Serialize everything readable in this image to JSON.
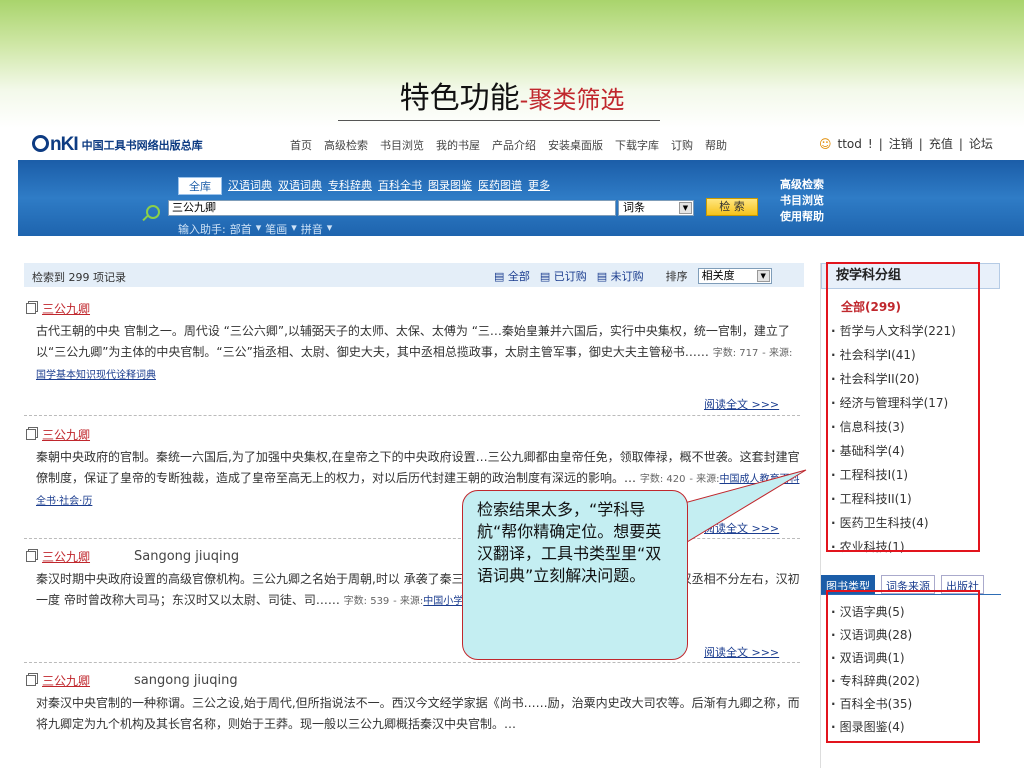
{
  "slide": {
    "title": "特色功能",
    "subtitle": "-聚类筛选"
  },
  "header": {
    "logo_mark": "nKI",
    "logo_text": "中国工具书网络出版总库",
    "nav": [
      "首页",
      "高级检索",
      "书目浏览",
      "我的书屋",
      "产品介绍",
      "安装桌面版",
      "下载字库",
      "订购",
      "帮助"
    ],
    "user": {
      "name": "ttod",
      "links": [
        "注销",
        "充值",
        "论坛"
      ]
    }
  },
  "search": {
    "tabs": [
      "全库",
      "汉语词典",
      "双语词典",
      "专科辞典",
      "百科全书",
      "图录图鉴",
      "医药图谱",
      "更多"
    ],
    "query": "三公九卿",
    "field": "词条",
    "button": "检 索",
    "helper_label": "输入助手:",
    "helpers": [
      "部首",
      "笔画",
      "拼音"
    ],
    "right_links": [
      "高级检索",
      "书目浏览",
      "使用帮助"
    ]
  },
  "resultbar": {
    "count": "检索到 299 项记录",
    "filters": [
      "全部",
      "已订购",
      "未订购"
    ],
    "sort_label": "排序",
    "sort_value": "相关度"
  },
  "records": [
    {
      "title": "三公九卿",
      "pinyin": "",
      "body": "古代王朝的中央 官制之一。周代设 “三公六卿”,以辅弼天子的太师、太保、太傅为 “三…秦始皇兼并六国后，实行中央集权，统一官制，建立了以“三公九卿”为主体的中央官制。“三公”指丞相、太尉、御史大夫，其中丞相总揽政事，太尉主管军事，御史大夫主管秘书……",
      "words": "字数: 717",
      "source_label": "- 来源:",
      "source": "国学基本知识现代诠释词典",
      "readmore": "阅读全文 >>>"
    },
    {
      "title": "三公九卿",
      "pinyin": "",
      "body": "秦朝中央政府的官制。秦统一六国后,为了加强中央集权,在皇帝之下的中央政府设置…三公九卿都由皇帝任免，领取俸禄，概不世袭。这套封建官僚制度，保证了皇帝的专断独裁，造成了皇帝至高无上的权力，对以后历代封建王朝的政治制度有深远的影响。…",
      "words": "字数: 420",
      "source_label": "- 来源:",
      "source": "中国成人教育百科全书·社会·历",
      "readmore": "阅读全文 >>>"
    },
    {
      "title": "三公九卿",
      "pinyin": "Sangong jiuqing",
      "body": "秦汉时期中央政府设置的高级官僚机构。三公九卿之名始于周朝,时以  承袭了秦三公九卿制，只是在名称上稍有更改，如，汉丞相不分左右，汉初一度  帝时曾改称大司马；东汉时又以太尉、司徒、司……",
      "words": "字数: 539",
      "source_label": "- 来源:",
      "source": "中国小学",
      "readmore": "阅读全文 >>>"
    },
    {
      "title": "三公九卿",
      "pinyin": "sangong jiuqing",
      "body": "对秦汉中央官制的一种称谓。三公之设,始于周代,但所指说法不一。西汉今文经学家据《尚书……励，治粟内史改大司农等。后渐有九卿之称，而将九卿定为九个机构及其长官名称，则始于王莽。现一般以三公九卿概括秦汉中央官制。…",
      "words": "",
      "source_label": "",
      "source": "",
      "readmore": ""
    }
  ],
  "sidebar": {
    "heading": "按学科分组",
    "all": "全部(299)",
    "subjects": [
      "哲学与人文科学(221)",
      "社会科学I(41)",
      "社会科学II(20)",
      "经济与管理科学(17)",
      "信息科技(3)",
      "基础科学(4)",
      "工程科技I(1)",
      "工程科技II(1)",
      "医药卫生科技(4)",
      "农业科技(1)"
    ],
    "tabs": [
      "图书类型",
      "词条来源",
      "出版社"
    ],
    "types": [
      "汉语字典(5)",
      "汉语词典(28)",
      "双语词典(1)",
      "专科辞典(202)",
      "百科全书(35)",
      "图录图鉴(4)"
    ]
  },
  "callout": {
    "text": "检索结果太多，“学科导航“帮你精确定位。想要英汉翻译，工具书类型里“双语词典”立刻解决问题。"
  },
  "colors": {
    "accent_red": "#c0272d",
    "band_blue": "#1b5da8",
    "box_red": "#e2141d",
    "callout_bg": "#c4eef2"
  }
}
